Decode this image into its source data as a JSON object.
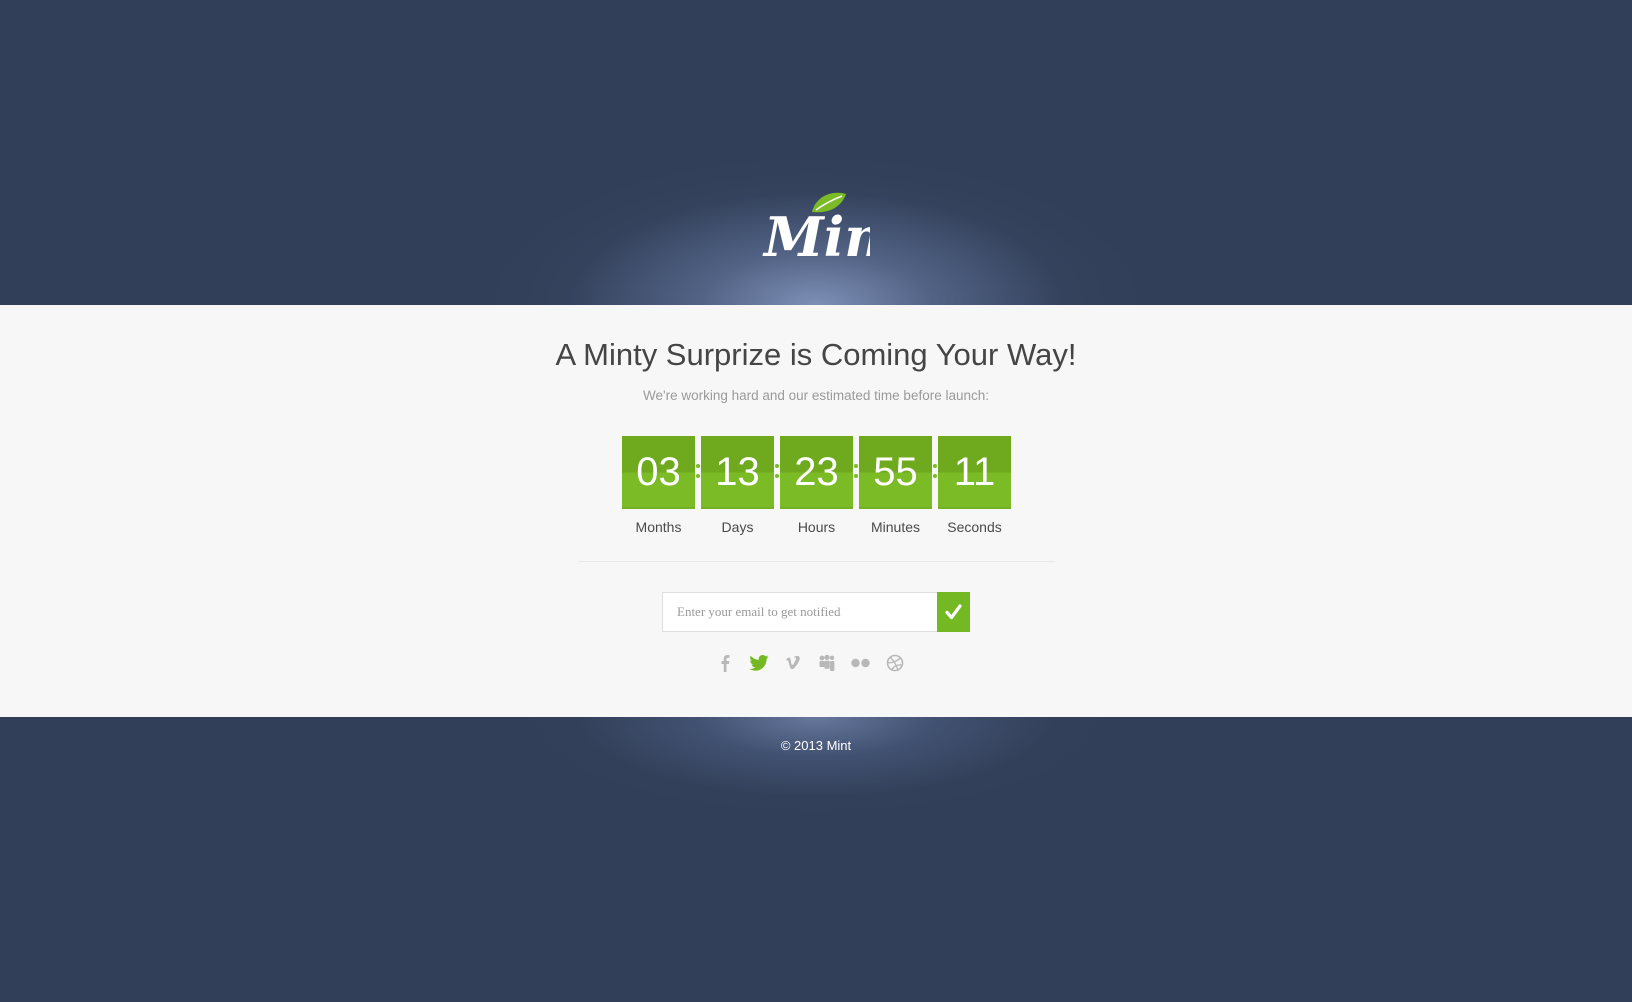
{
  "header": {
    "logo_text": "Mint",
    "logo_icon": "leaf-icon"
  },
  "main": {
    "headline": "A Minty Surprize is Coming Your Way!",
    "subline": "We're working hard and our estimated time before launch:",
    "countdown": [
      {
        "value": "03",
        "label": "Months"
      },
      {
        "value": "13",
        "label": "Days"
      },
      {
        "value": "23",
        "label": "Hours"
      },
      {
        "value": "55",
        "label": "Minutes"
      },
      {
        "value": "11",
        "label": "Seconds"
      }
    ],
    "email": {
      "placeholder": "Enter your email to get notified",
      "value": "",
      "submit_icon": "checkmark-icon"
    },
    "social": [
      {
        "name": "facebook-icon",
        "active": false
      },
      {
        "name": "twitter-icon",
        "active": true
      },
      {
        "name": "vimeo-icon",
        "active": false
      },
      {
        "name": "myspace-icon",
        "active": false
      },
      {
        "name": "flickr-icon",
        "active": false
      },
      {
        "name": "dribbble-icon",
        "active": false
      }
    ]
  },
  "footer": {
    "copyright": "© 2013 Mint"
  },
  "colors": {
    "navy": "#313f58",
    "green": "#74b824",
    "green_dark": "#6faa1e",
    "content_bg": "#f7f7f7",
    "icon_gray": "#b5b5b5"
  }
}
